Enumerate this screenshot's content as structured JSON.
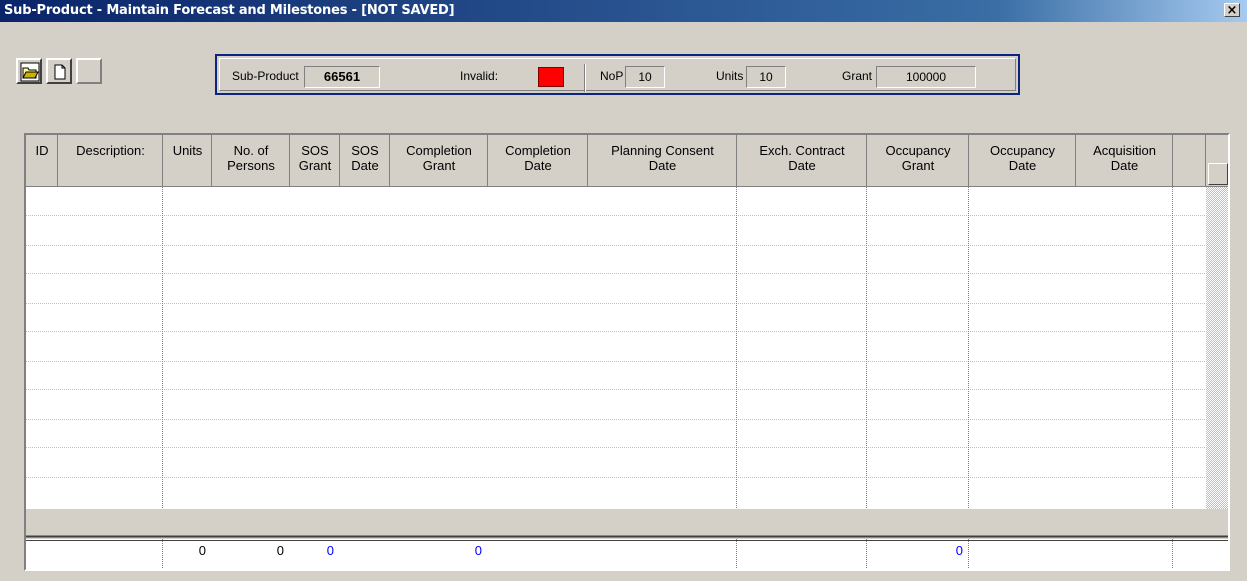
{
  "window": {
    "title": "Sub-Product - Maintain Forecast and Milestones - [NOT SAVED]",
    "close_glyph": "×"
  },
  "toolbar": {
    "buttons": [
      {
        "name": "open-button",
        "icon": "open-folder-icon",
        "enabled": true
      },
      {
        "name": "new-button",
        "icon": "new-document-icon",
        "enabled": true
      },
      {
        "name": "blank-button",
        "icon": "blank-icon",
        "enabled": false
      }
    ]
  },
  "info": {
    "subproduct_label": "Sub-Product",
    "subproduct_value": "66561",
    "invalid_label": "Invalid:",
    "invalid_color": "#ff0000",
    "nop_label": "NoP",
    "nop_value": "10",
    "units_label": "Units",
    "units_value": "10",
    "grant_label": "Grant",
    "grant_value": "100000"
  },
  "grid": {
    "columns": [
      [
        "ID"
      ],
      [
        "Description:"
      ],
      [
        "Units"
      ],
      [
        "No. of",
        "Persons"
      ],
      [
        "SOS",
        "Grant"
      ],
      [
        "SOS",
        "Date"
      ],
      [
        "Completion",
        "Grant"
      ],
      [
        "Completion",
        "Date"
      ],
      [
        "Planning Consent",
        "Date"
      ],
      [
        "Exch. Contract",
        "Date"
      ],
      [
        "Occupancy",
        "Grant"
      ],
      [
        "Occupancy",
        "Date"
      ],
      [
        "Acquisition",
        "Date"
      ]
    ],
    "empty_rows": 12,
    "totals": {
      "units": "0",
      "persons": "0",
      "sos_grant": "0",
      "completion_grant": "0",
      "occupancy_grant": "0"
    },
    "total_value_color": "#0000ff"
  }
}
